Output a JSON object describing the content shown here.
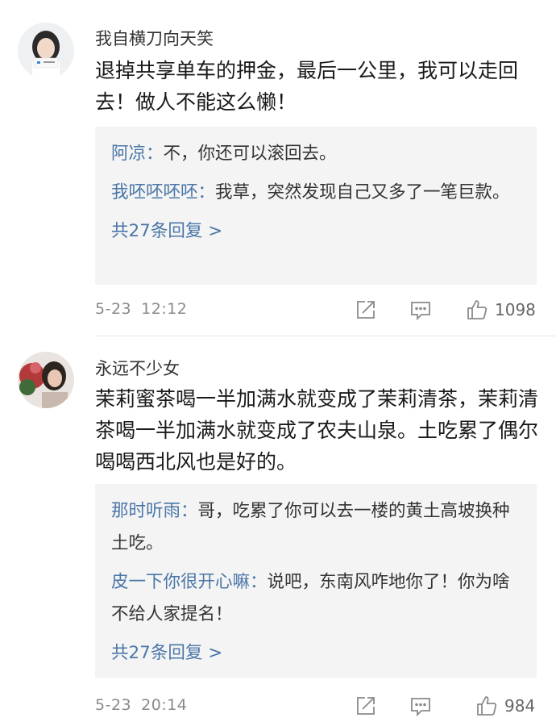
{
  "comments": [
    {
      "username": "我自横刀向天笑",
      "text": "退掉共享单车的押金，最后一公里，我可以走回去！做人不能这么懒！",
      "replies": [
        {
          "user": "阿凉",
          "sep": "：",
          "text": "不，你还可以滚回去。"
        },
        {
          "user": "我呸呸呸呸",
          "sep": "：",
          "text": "我草，突然发现自己又多了一笔巨款。"
        }
      ],
      "more_replies": "共27条回复 >",
      "date": "5-23",
      "time": "12:12",
      "likes": "1098"
    },
    {
      "username": "永远不少女",
      "text": "茉莉蜜茶喝一半加满水就变成了茉莉清茶，茉莉清茶喝一半加满水就变成了农夫山泉。土吃累了偶尔喝喝西北风也是好的。",
      "replies": [
        {
          "user": "那时听雨",
          "sep": "：",
          "text": "哥，吃累了你可以去一楼的黄土高坡换种土吃。"
        },
        {
          "user": "皮一下你很开心嘛",
          "sep": "：",
          "text": "说吧，东南风咋地你了！你为啥不给人家提名！"
        }
      ],
      "more_replies": "共27条回复 >",
      "date": "5-23",
      "time": "20:14",
      "likes": "984"
    }
  ],
  "icons": {
    "share": "share-icon",
    "comment": "comment-icon",
    "like": "thumbs-up-icon"
  },
  "colors": {
    "reply_user": "#4a76a8",
    "meta_gray": "#8a8a8a",
    "reply_bg": "#f4f4f4"
  }
}
